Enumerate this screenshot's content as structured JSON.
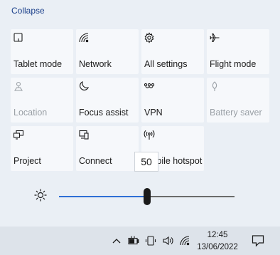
{
  "panel": {
    "collapse_label": "Collapse",
    "tiles": [
      {
        "label": "Tablet mode",
        "icon": "tablet-mode-icon",
        "enabled": true
      },
      {
        "label": "Network",
        "icon": "network-icon",
        "enabled": true
      },
      {
        "label": "All settings",
        "icon": "gear-icon",
        "enabled": true
      },
      {
        "label": "Flight mode",
        "icon": "airplane-icon",
        "enabled": true
      },
      {
        "label": "Location",
        "icon": "location-icon",
        "enabled": false
      },
      {
        "label": "Focus assist",
        "icon": "moon-icon",
        "enabled": true
      },
      {
        "label": "VPN",
        "icon": "vpn-icon",
        "enabled": true
      },
      {
        "label": "Battery saver",
        "icon": "leaf-icon",
        "enabled": false
      },
      {
        "label": "Project",
        "icon": "project-icon",
        "enabled": true
      },
      {
        "label": "Connect",
        "icon": "connect-icon",
        "enabled": true
      },
      {
        "label": "Mobile hotspot",
        "icon": "hotspot-icon",
        "enabled": true
      }
    ]
  },
  "brightness": {
    "value": 50,
    "tooltip": "50",
    "icon": "sun-icon"
  },
  "taskbar": {
    "time": "12:45",
    "date": "13/06/2022",
    "tray_icons": [
      "chevron-up-icon",
      "battery-icon",
      "pen-icon",
      "volume-icon",
      "wifi-icon"
    ],
    "notification_icon": "notification-icon"
  },
  "colors": {
    "accent": "#2e6fd6",
    "panel_bg": "#eaeff5",
    "tile_bg": "#f6f8fb"
  }
}
